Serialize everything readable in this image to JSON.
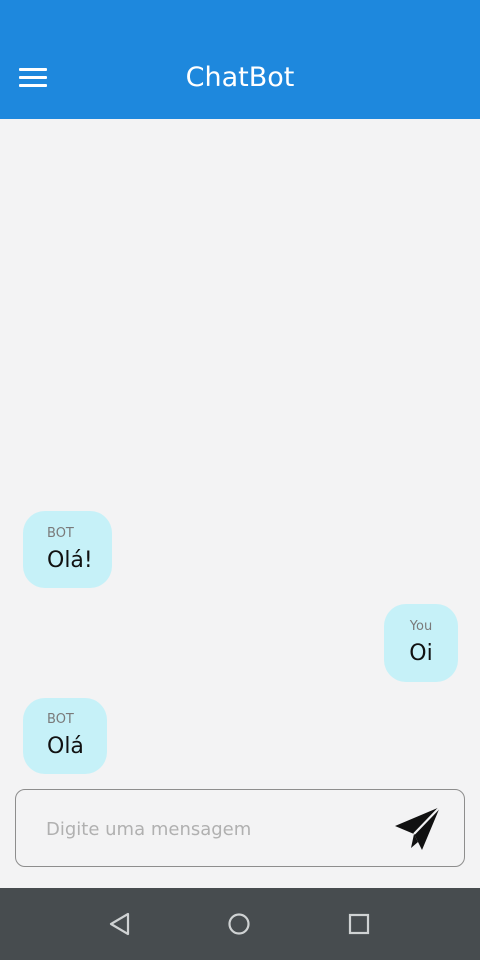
{
  "appbar": {
    "title": "ChatBot",
    "menu_icon": "hamburger-menu-icon",
    "color": "#1e88dd"
  },
  "messages": [
    {
      "sender": "BOT",
      "text": "Olá!"
    },
    {
      "sender": "You",
      "text": "Oi"
    },
    {
      "sender": "BOT",
      "text": "Olá"
    }
  ],
  "composer": {
    "placeholder": "Digite uma mensagem",
    "value": "",
    "send_icon": "send-paper-plane-icon"
  },
  "bubble_color": "#c6f1f8",
  "navbar": {
    "back_icon": "back-triangle-icon",
    "home_icon": "home-circle-icon",
    "recent_icon": "recent-apps-square-icon"
  }
}
